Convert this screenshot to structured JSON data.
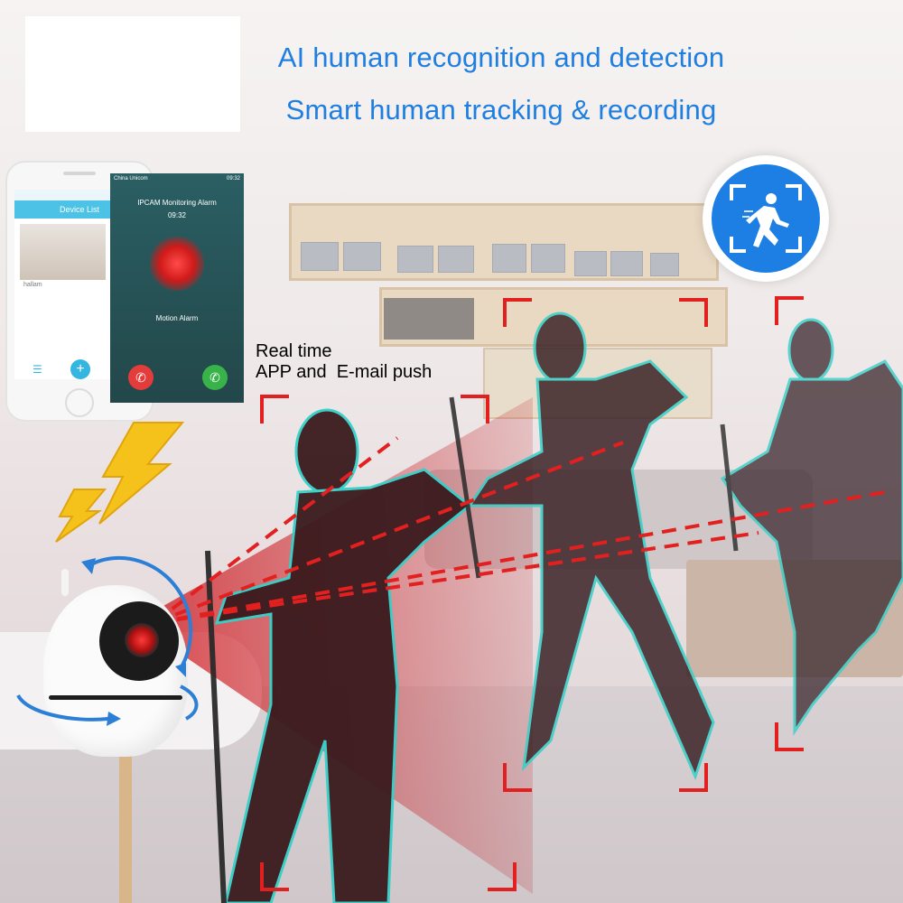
{
  "headline": {
    "line1": "AI human recognition and detection",
    "line2": "Smart human tracking & recording"
  },
  "push": {
    "label": "Real time\nAPP and  E-mail push"
  },
  "phone_app": {
    "header": "Device List",
    "device_name": "hallam"
  },
  "phone_alarm": {
    "status_left": "China Unicom",
    "status_right": "09:32",
    "title": "IPCAM Monitoring Alarm",
    "time": "09:32",
    "caption": "Motion Alarm"
  },
  "colors": {
    "headline": "#1e7fe0",
    "bracket": "#e32020",
    "outline": "#35d0c8",
    "badge": "#1d7fe3",
    "bolt": "#f4c21a"
  },
  "icons": {
    "badge": "human-detection-icon",
    "bolt": "lightning-bolt-icon",
    "rotate": "rotation-arrow-icon"
  }
}
